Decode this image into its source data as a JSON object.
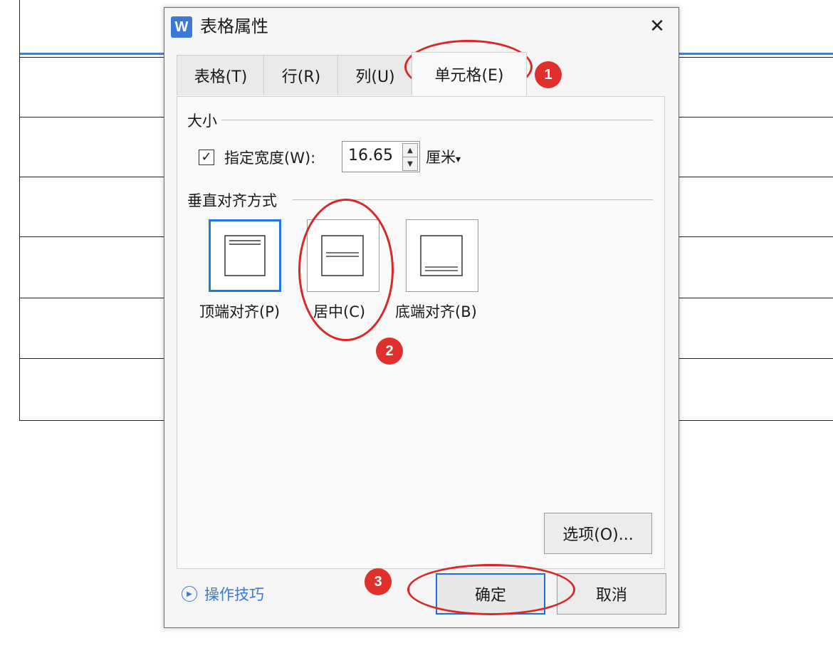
{
  "dialog": {
    "icon_letter": "W",
    "title": "表格属性",
    "close_glyph": "✕",
    "tabs": [
      {
        "label": "表格(T)"
      },
      {
        "label": "行(R)"
      },
      {
        "label": "列(U)"
      },
      {
        "label": "单元格(E)",
        "active": true
      }
    ],
    "size_section": {
      "label": "大小",
      "width_checkbox_checked": true,
      "width_label": "指定宽度(W):",
      "width_value": "16.65",
      "unit_label": "厘米",
      "unit_caret": "▾"
    },
    "valign_section": {
      "label": "垂直对齐方式",
      "options": [
        {
          "label": "顶端对齐(P)",
          "selected": true
        },
        {
          "label": "居中(C)",
          "selected": false
        },
        {
          "label": "底端对齐(B)",
          "selected": false
        }
      ]
    },
    "options_button": "选项(O)...",
    "tips_label": "操作技巧",
    "ok_button": "确定",
    "cancel_button": "取消"
  },
  "annotations": {
    "badge_1": "1",
    "badge_2": "2",
    "badge_3": "3",
    "color": "#d62a2a"
  },
  "colors": {
    "accent": "#1f7ae0",
    "app_icon": "#3b78d8",
    "table_header_rule": "#4a7ec1"
  }
}
